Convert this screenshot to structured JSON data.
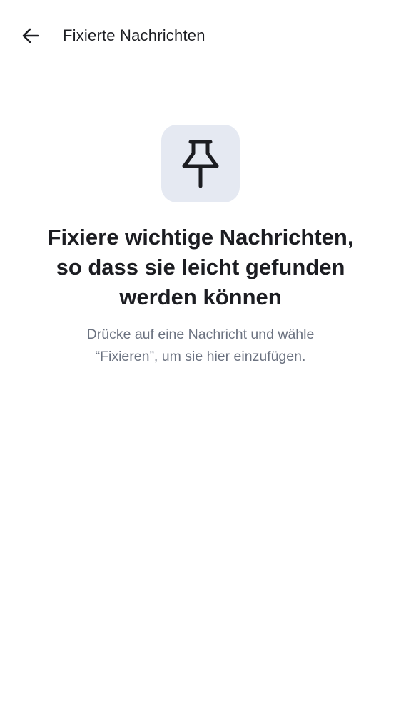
{
  "header": {
    "back_icon": "arrow-left-icon",
    "title": "Fixierte Nachrichten"
  },
  "empty_state": {
    "icon": "pin-icon",
    "headline_lines": [
      "Fixiere wichtige Nachrichten,",
      "so dass sie leicht gefunden",
      "werden können"
    ],
    "hint_lines": [
      "Drücke auf eine Nachricht und wähle",
      "“Fixieren”, um sie hier einzufügen."
    ]
  },
  "colors": {
    "background": "#ffffff",
    "text_primary": "#1c1d22",
    "text_secondary": "#6b7280",
    "icon_tile": "#e5e9f2"
  }
}
